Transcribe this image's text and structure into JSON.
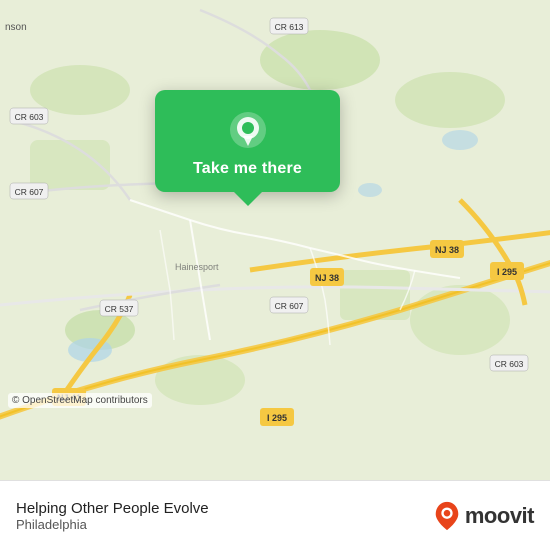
{
  "map": {
    "attribution": "© OpenStreetMap contributors",
    "background_color": "#e8f0d8"
  },
  "popup": {
    "label": "Take me there",
    "pin_icon": "location-pin"
  },
  "bottom_bar": {
    "app_name": "Helping Other People Evolve",
    "app_city": "Philadelphia",
    "moovit_text": "moovit"
  },
  "road_labels": [
    "CR 613",
    "CR 603",
    "CR 607",
    "I 295",
    "NJ 38",
    "NJ 41",
    "CR 537",
    "CR 607",
    "I 295",
    "CR 603",
    "nson"
  ]
}
